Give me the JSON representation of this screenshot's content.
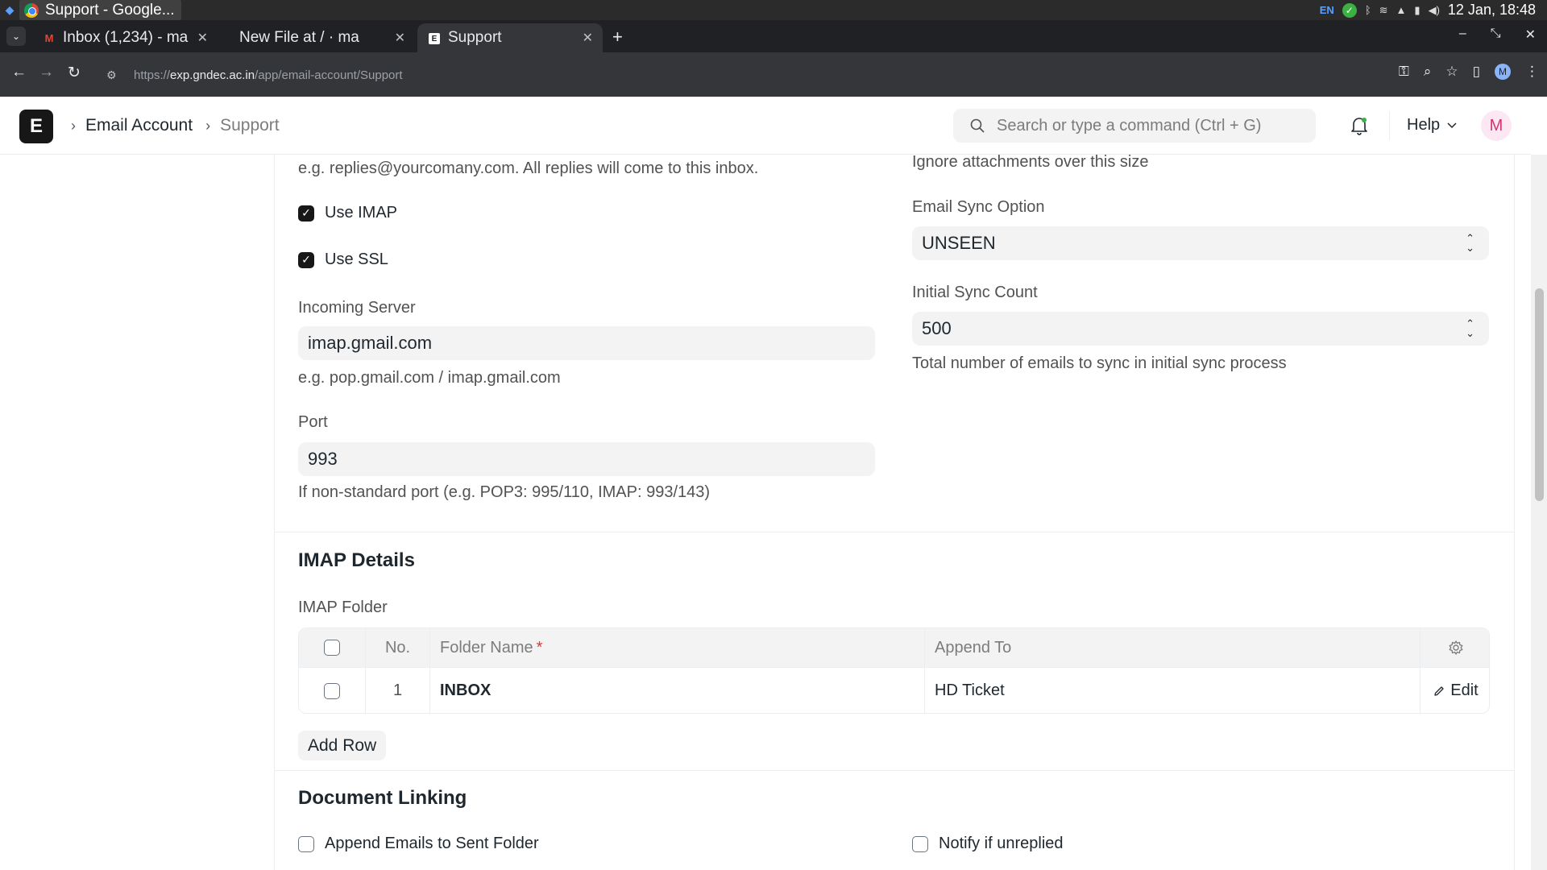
{
  "os": {
    "active_window": "Support - Google...",
    "lang": "EN",
    "datetime": "12 Jan, 18:48"
  },
  "browser": {
    "tabs": [
      {
        "icon": "gmail-icon",
        "title": "Inbox (1,234) - ma"
      },
      {
        "icon": "document-icon",
        "title": "New File at / · ma"
      },
      {
        "icon": "frappe-icon",
        "title": "Support"
      }
    ],
    "url_prefix": "https://",
    "url_host": "exp.gndec.ac.in",
    "url_path": "/app/email-account/Support",
    "profile_initial": "M"
  },
  "app": {
    "logo_letter": "E",
    "breadcrumbs": [
      "Email Account",
      "Support"
    ],
    "search_placeholder": "Search or type a command (Ctrl + G)",
    "help_label": "Help",
    "user_initial": "M"
  },
  "form": {
    "left": {
      "email_desc": "e.g. replies@yourcomany.com. All replies will come to this inbox.",
      "use_imap": {
        "label": "Use IMAP",
        "checked": true
      },
      "use_ssl": {
        "label": "Use SSL",
        "checked": true
      },
      "incoming_server": {
        "label": "Incoming Server",
        "value": "imap.gmail.com",
        "desc": "e.g. pop.gmail.com / imap.gmail.com"
      },
      "port": {
        "label": "Port",
        "value": "993",
        "desc": "If non-standard port (e.g. POP3: 995/110, IMAP: 993/143)"
      }
    },
    "right": {
      "attachment_desc": "Ignore attachments over this size",
      "email_sync_option": {
        "label": "Email Sync Option",
        "value": "UNSEEN"
      },
      "initial_sync_count": {
        "label": "Initial Sync Count",
        "value": "500",
        "desc": "Total number of emails to sync in initial sync process"
      }
    },
    "imap_details": {
      "title": "IMAP Details",
      "folder_label": "IMAP Folder",
      "columns": [
        "No.",
        "Folder Name",
        "Append To"
      ],
      "rows": [
        {
          "no": "1",
          "folder_name": "INBOX",
          "append_to": "HD Ticket"
        }
      ],
      "edit_label": "Edit",
      "add_row_label": "Add Row"
    },
    "document_linking": {
      "title": "Document Linking",
      "append_sent": {
        "label": "Append Emails to Sent Folder",
        "checked": false
      },
      "notify_unreplied": {
        "label": "Notify if unreplied",
        "checked": false
      }
    }
  }
}
